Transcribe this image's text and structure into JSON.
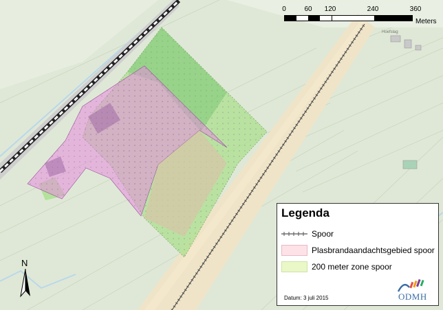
{
  "map": {
    "base_colors": {
      "land": "#dfe8d6",
      "field_stripe": "#edf2e8",
      "railway_bed": "#efe4c8",
      "water": "#b9d7ec",
      "buildings": "#c9c9c9"
    },
    "layers": [
      {
        "name": "plasbrand_zone",
        "color": "#e88be0",
        "opacity": 0.55
      },
      {
        "name": "200m_zone",
        "color": "#a8e08a",
        "opacity": 0.7
      }
    ]
  },
  "scalebar": {
    "ticks": [
      "0",
      "60",
      "120",
      "240",
      "360"
    ],
    "units": "Meters"
  },
  "legend": {
    "title": "Legenda",
    "items": [
      {
        "label": "Spoor",
        "symbol": "line",
        "color": "#555555"
      },
      {
        "label": "Plasbrandaandachtsgebied spoor",
        "symbol": "fill",
        "color": "#fde2e8"
      },
      {
        "label": "200 meter zone spoor",
        "symbol": "fill",
        "color": "#eaf8c8"
      }
    ],
    "date": "Datum: 3 juli 2015",
    "logo_text": "ODMH"
  },
  "north_arrow": {
    "label": "N"
  },
  "place_label": {
    "text": "Hoefslag"
  }
}
